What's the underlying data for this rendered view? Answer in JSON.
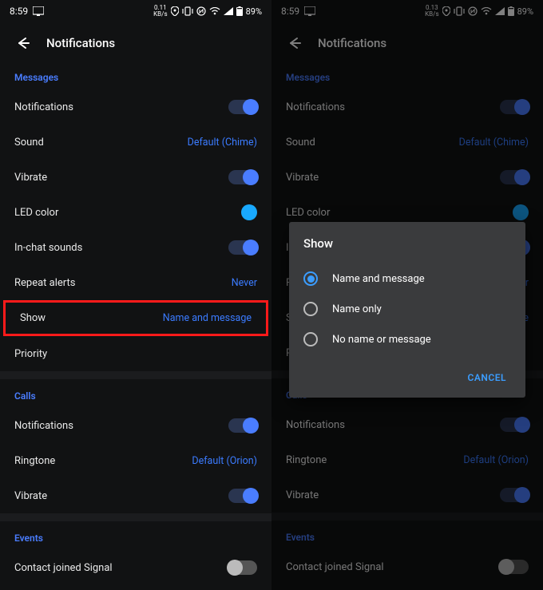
{
  "status": {
    "time": "8:59",
    "net_left": {
      "value": "0.11",
      "unit": "KB/s"
    },
    "net_right": {
      "value": "0.13",
      "unit": "KB/s"
    },
    "battery": "89%"
  },
  "header": {
    "title": "Notifications"
  },
  "sections": {
    "messages": {
      "label": "Messages",
      "notifications_label": "Notifications",
      "sound_label": "Sound",
      "sound_value": "Default (Chime)",
      "vibrate_label": "Vibrate",
      "led_label": "LED color",
      "inchat_label": "In-chat sounds",
      "repeat_label": "Repeat alerts",
      "repeat_value": "Never",
      "show_label": "Show",
      "show_value": "Name and message",
      "priority_label": "Priority"
    },
    "calls": {
      "label": "Calls",
      "notifications_label": "Notifications",
      "ringtone_label": "Ringtone",
      "ringtone_value": "Default (Orion)",
      "vibrate_label": "Vibrate"
    },
    "events": {
      "label": "Events",
      "contact_joined_label": "Contact joined Signal"
    }
  },
  "dialog": {
    "title": "Show",
    "options": {
      "o0": "Name and message",
      "o1": "Name only",
      "o2": "No name or message"
    },
    "cancel": "CANCEL"
  }
}
